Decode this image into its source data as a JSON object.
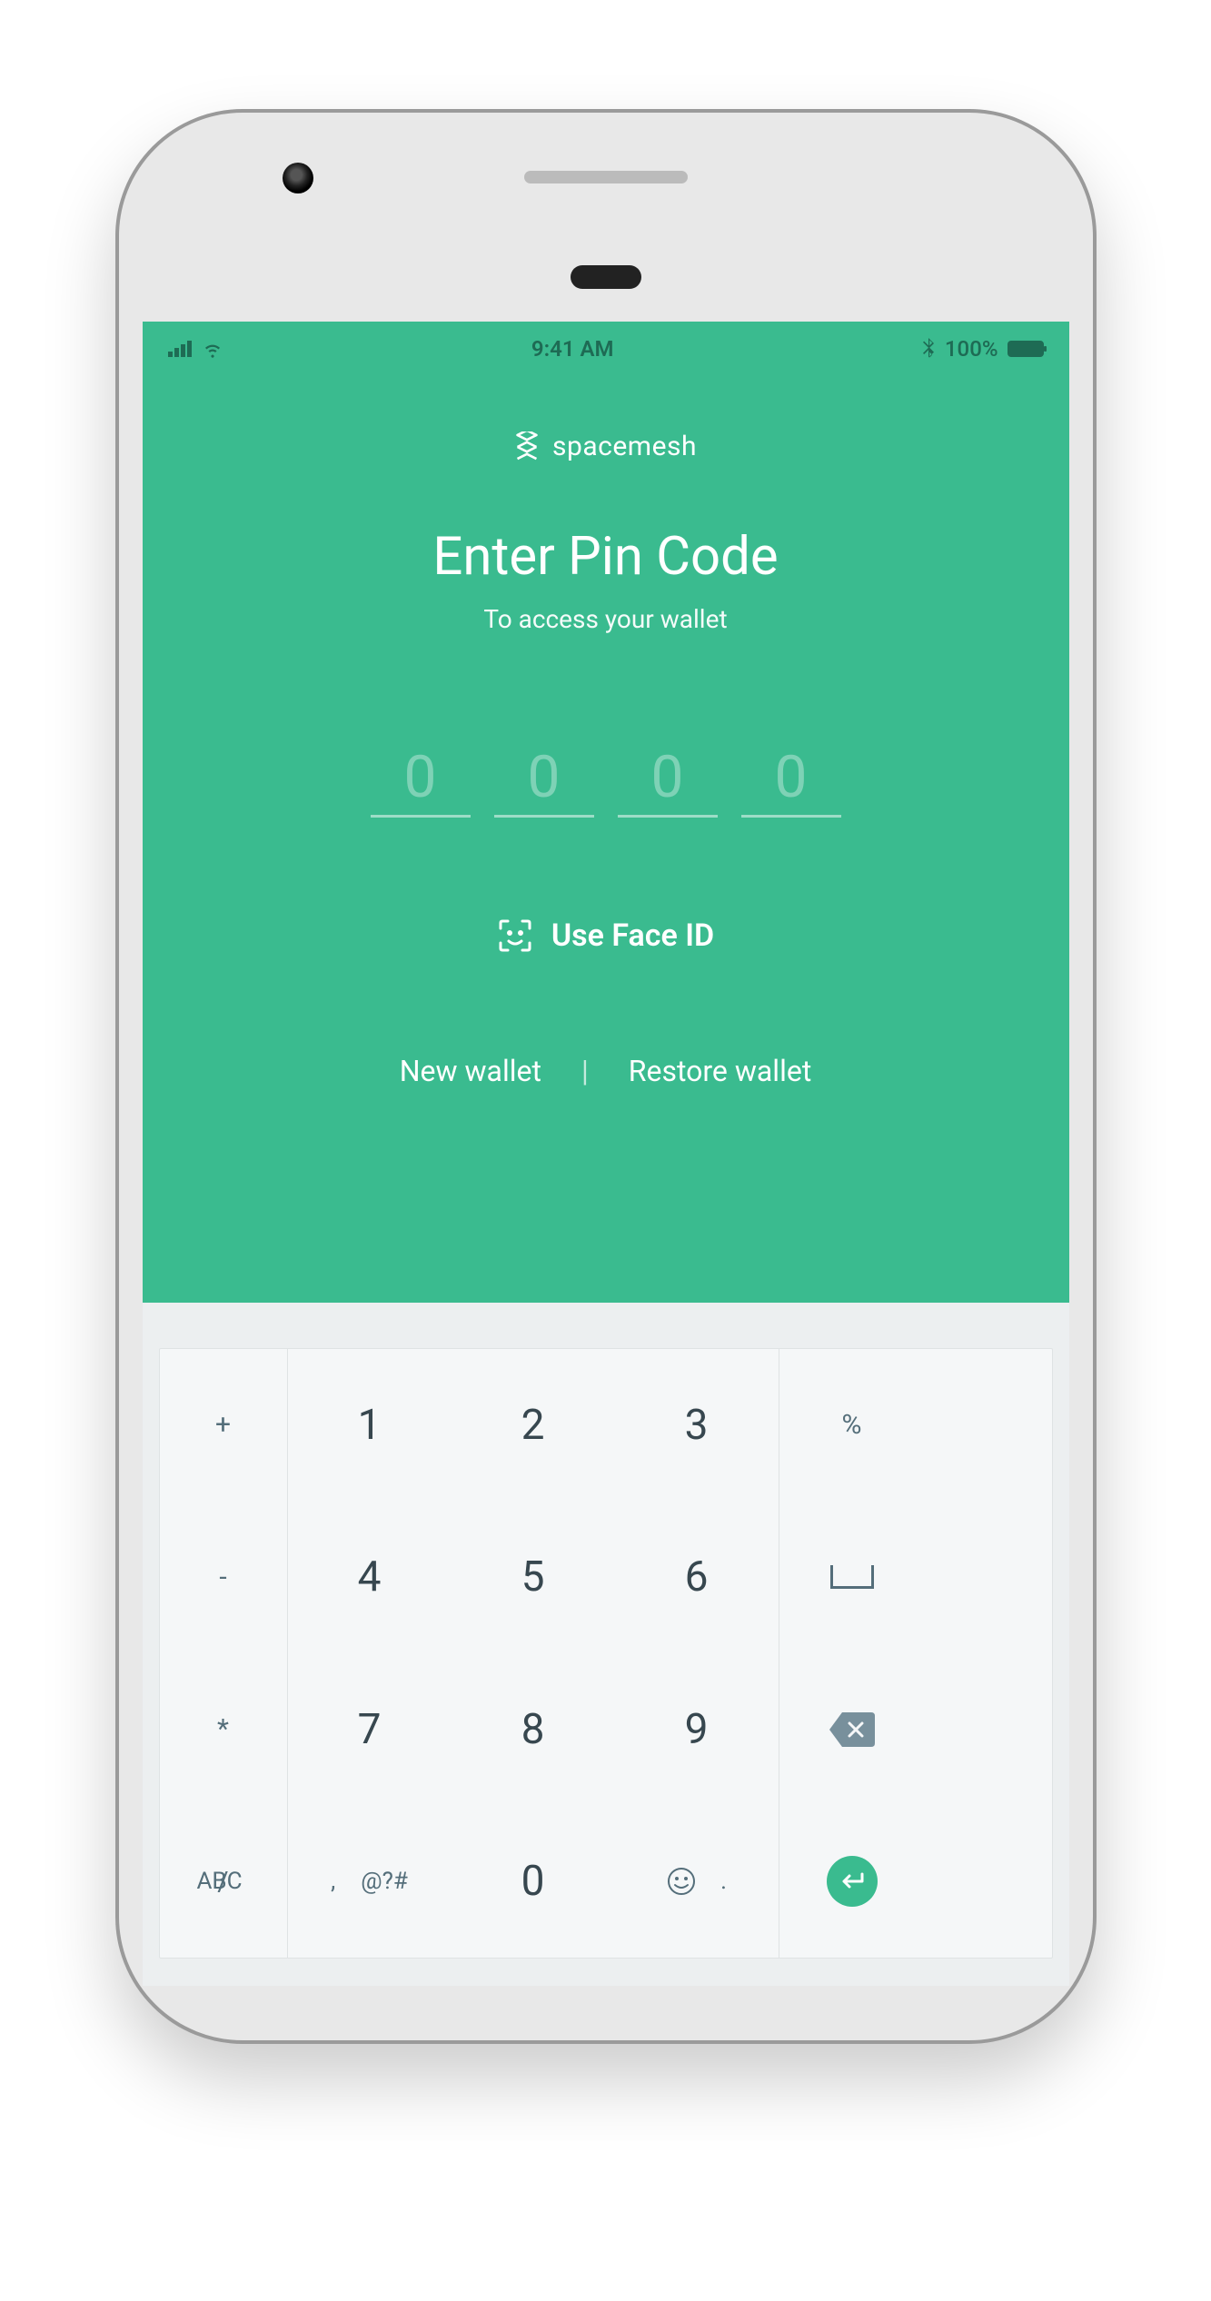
{
  "status": {
    "time": "9:41 AM",
    "battery_pct": "100%"
  },
  "brand": "spacemesh",
  "title": "Enter Pin Code",
  "subtitle": "To access your wallet",
  "pin": {
    "placeholders": [
      "0",
      "0",
      "0",
      "0"
    ]
  },
  "face_id_label": "Use Face ID",
  "links": {
    "new_wallet": "New wallet",
    "restore_wallet": "Restore wallet",
    "divider": "|"
  },
  "keyboard": {
    "side_left": [
      "+",
      "-",
      "*",
      "/"
    ],
    "digits": [
      "1",
      "2",
      "3",
      "4",
      "5",
      "6",
      "7",
      "8",
      "9",
      "0"
    ],
    "side_right_pct": "%",
    "abc": "ABC",
    "comma": ",",
    "symbols": "@?#",
    "period": "."
  }
}
